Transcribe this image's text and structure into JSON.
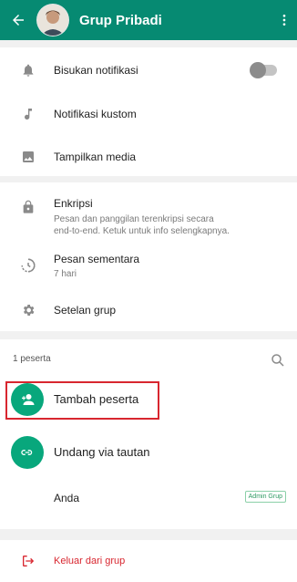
{
  "appbar": {
    "title": "Grup Pribadi",
    "back_icon": "arrow-left-icon",
    "menu_icon": "more-vert-icon",
    "bg": "#068a72"
  },
  "settings": {
    "mute_label": "Bisukan notifikasi",
    "custom_notif_label": "Notifikasi kustom",
    "media_label": "Tampilkan media",
    "mute_enabled": false
  },
  "privacy": {
    "encryption_label": "Enkripsi",
    "encryption_desc_line1": "Pesan dan panggilan terenkripsi secara",
    "encryption_desc_line2": "end-to-end. Ketuk untuk info selengkapnya.",
    "disappearing_label": "Pesan sementara",
    "disappearing_value": "7 hari",
    "group_settings_label": "Setelan grup"
  },
  "participants": {
    "count_label": "1 peserta",
    "add_label": "Tambah peserta",
    "invite_label": "Undang via tautan",
    "member_name": "Anda",
    "admin_badge": "Admin Grup"
  },
  "footer": {
    "exit_label": "Keluar dari grup",
    "exit_color": "#d8262f"
  },
  "colors": {
    "accent": "#08a77c",
    "highlight": "#d8262f"
  }
}
